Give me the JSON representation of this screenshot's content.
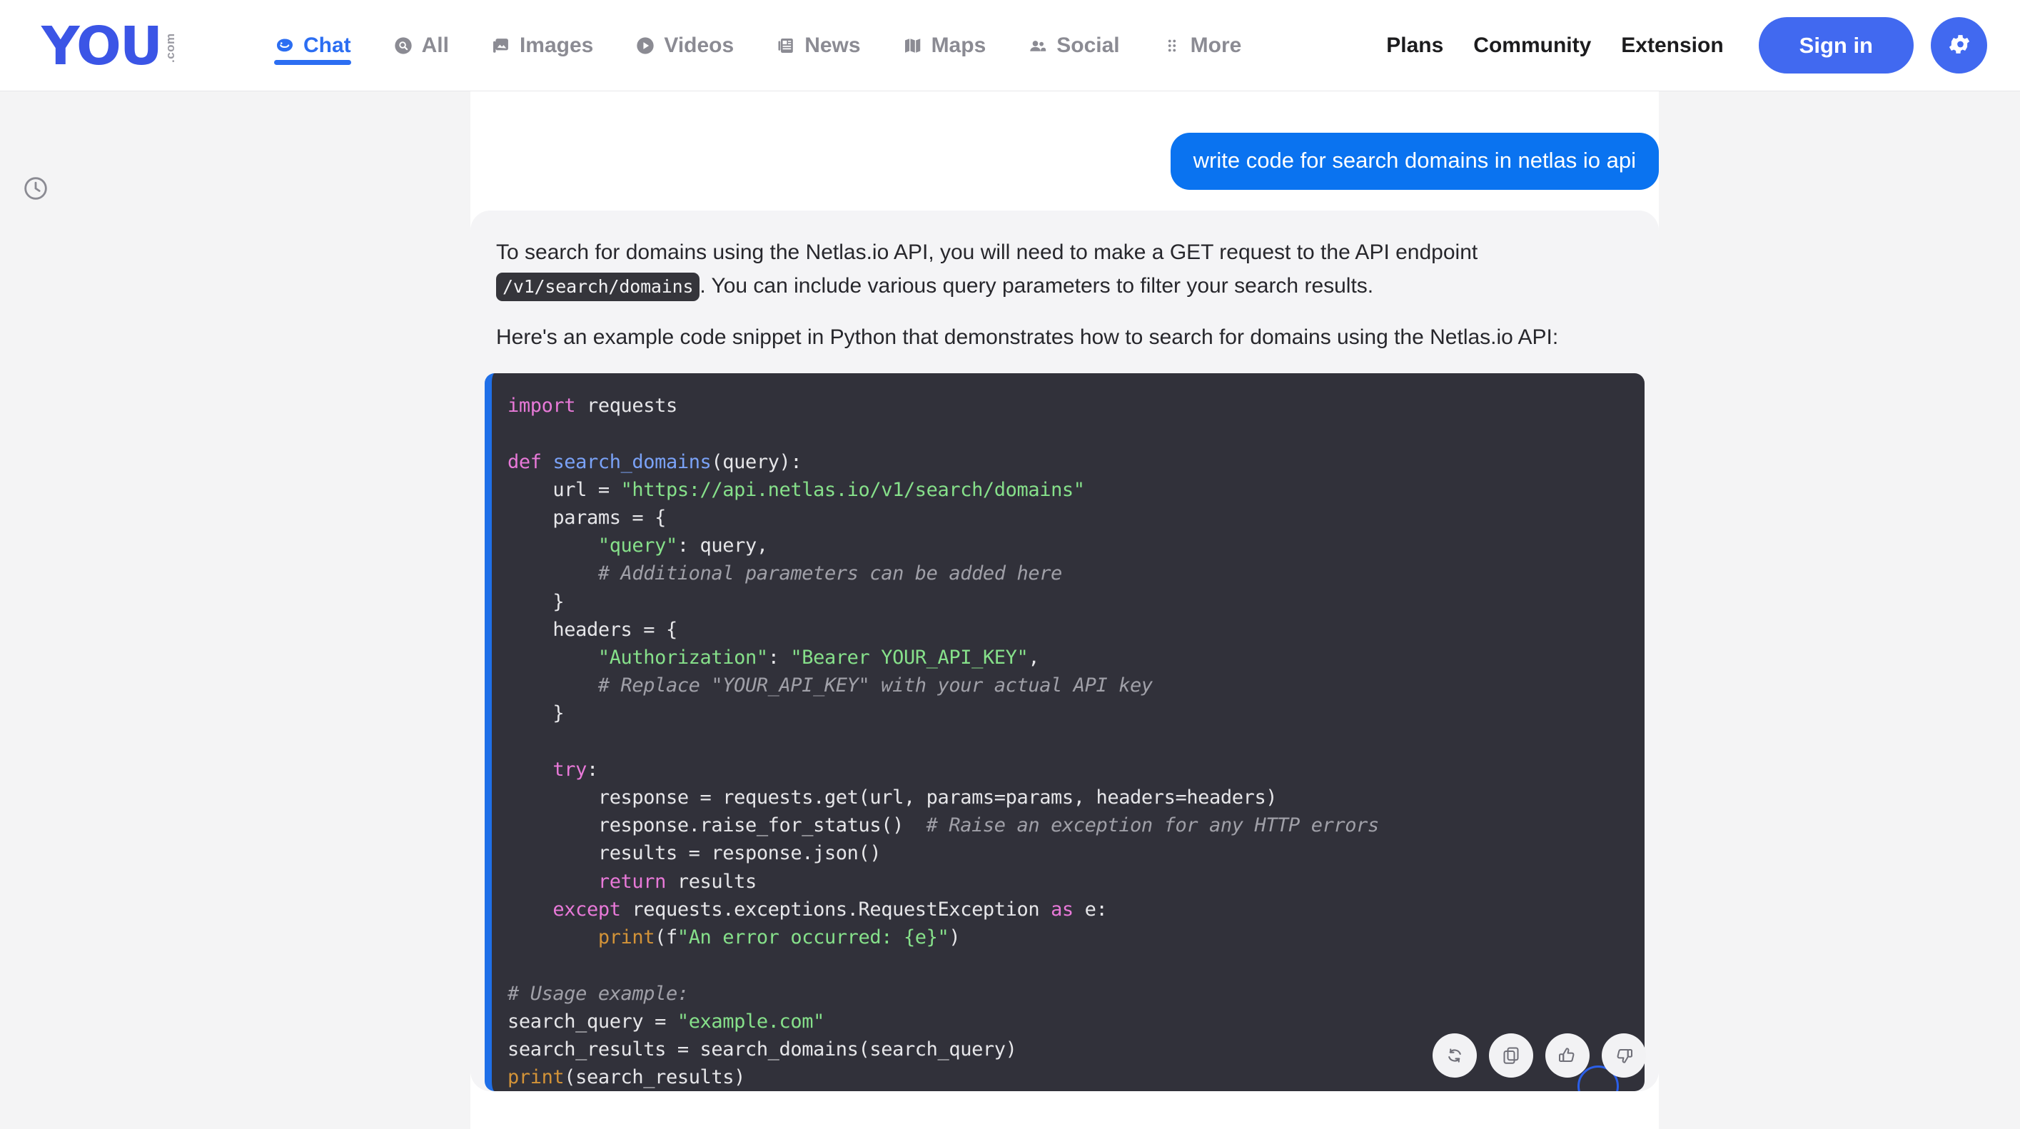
{
  "header": {
    "logo": {
      "text": "YOU",
      "suffix": ".com"
    },
    "nav_tabs": [
      {
        "label": "Chat",
        "icon": "chat-blob-icon",
        "active": true
      },
      {
        "label": "All",
        "icon": "search-circle-icon",
        "active": false
      },
      {
        "label": "Images",
        "icon": "image-icon",
        "active": false
      },
      {
        "label": "Videos",
        "icon": "play-circle-icon",
        "active": false
      },
      {
        "label": "News",
        "icon": "newspaper-icon",
        "active": false
      },
      {
        "label": "Maps",
        "icon": "map-icon",
        "active": false
      },
      {
        "label": "Social",
        "icon": "people-icon",
        "active": false
      },
      {
        "label": "More",
        "icon": "dots-grid-icon",
        "active": false
      }
    ],
    "links": [
      {
        "label": "Plans"
      },
      {
        "label": "Community"
      },
      {
        "label": "Extension"
      }
    ],
    "sign_in_label": "Sign in",
    "settings_icon": "gear-icon",
    "accent_color": "#4169f0",
    "logo_color": "#3b55e6"
  },
  "sidebar": {
    "history_icon": "clock-icon"
  },
  "conversation": {
    "user_message": "write code for search domains in netlas io api",
    "user_bubble_color": "#0a73f0",
    "assistant": {
      "paragraph_1_before": "To search for domains using the Netlas.io API, you will need to make a GET request to the API endpoint ",
      "inline_code": "/v1/search/domains",
      "paragraph_1_after": ". You can include various query parameters to filter your search results.",
      "paragraph_2": "Here's an example code snippet in Python that demonstrates how to search for domains using the Netlas.io API:",
      "code": {
        "language": "python",
        "accent_bar_color": "#1f6fe8",
        "background": "#31313a",
        "lines": [
          [
            {
              "t": "import",
              "c": "kw"
            },
            {
              "t": " requests",
              "c": "pl"
            }
          ],
          [],
          [
            {
              "t": "def",
              "c": "kw"
            },
            {
              "t": " ",
              "c": "pl"
            },
            {
              "t": "search_domains",
              "c": "fn"
            },
            {
              "t": "(query):",
              "c": "pl"
            }
          ],
          [
            {
              "t": "    url = ",
              "c": "pl"
            },
            {
              "t": "\"https://api.netlas.io/v1/search/domains\"",
              "c": "str"
            }
          ],
          [
            {
              "t": "    params = {",
              "c": "pl"
            }
          ],
          [
            {
              "t": "        ",
              "c": "pl"
            },
            {
              "t": "\"query\"",
              "c": "str"
            },
            {
              "t": ": query,",
              "c": "pl"
            }
          ],
          [
            {
              "t": "        # Additional parameters can be added here",
              "c": "com"
            }
          ],
          [
            {
              "t": "    }",
              "c": "pl"
            }
          ],
          [
            {
              "t": "    headers = {",
              "c": "pl"
            }
          ],
          [
            {
              "t": "        ",
              "c": "pl"
            },
            {
              "t": "\"Authorization\"",
              "c": "str"
            },
            {
              "t": ": ",
              "c": "pl"
            },
            {
              "t": "\"Bearer YOUR_API_KEY\"",
              "c": "str"
            },
            {
              "t": ",",
              "c": "pl"
            }
          ],
          [
            {
              "t": "        # Replace \"YOUR_API_KEY\" with your actual API key",
              "c": "com"
            }
          ],
          [
            {
              "t": "    }",
              "c": "pl"
            }
          ],
          [],
          [
            {
              "t": "    ",
              "c": "pl"
            },
            {
              "t": "try",
              "c": "kw"
            },
            {
              "t": ":",
              "c": "pl"
            }
          ],
          [
            {
              "t": "        response = requests.get(url, params=params, headers=headers)",
              "c": "pl"
            }
          ],
          [
            {
              "t": "        response.raise_for_status()  ",
              "c": "pl"
            },
            {
              "t": "# Raise an exception for any HTTP errors",
              "c": "com"
            }
          ],
          [
            {
              "t": "        results = response.json()",
              "c": "pl"
            }
          ],
          [
            {
              "t": "        ",
              "c": "pl"
            },
            {
              "t": "return",
              "c": "kw"
            },
            {
              "t": " results",
              "c": "pl"
            }
          ],
          [
            {
              "t": "    ",
              "c": "pl"
            },
            {
              "t": "except",
              "c": "kw"
            },
            {
              "t": " requests.exceptions.RequestException ",
              "c": "pl"
            },
            {
              "t": "as",
              "c": "kw"
            },
            {
              "t": " e:",
              "c": "pl"
            }
          ],
          [
            {
              "t": "        ",
              "c": "pl"
            },
            {
              "t": "print",
              "c": "bi"
            },
            {
              "t": "(f",
              "c": "pl"
            },
            {
              "t": "\"An error occurred: {e}\"",
              "c": "str"
            },
            {
              "t": ")",
              "c": "pl"
            }
          ],
          [],
          [
            {
              "t": "# Usage example:",
              "c": "com"
            }
          ],
          [
            {
              "t": "search_query = ",
              "c": "pl"
            },
            {
              "t": "\"example.com\"",
              "c": "str"
            }
          ],
          [
            {
              "t": "search_results = search_domains(search_query)",
              "c": "pl"
            }
          ],
          [
            {
              "t": "print",
              "c": "bi"
            },
            {
              "t": "(search_results)",
              "c": "pl"
            }
          ]
        ]
      }
    },
    "actions": [
      {
        "icon": "regenerate-icon",
        "name": "regenerate"
      },
      {
        "icon": "copy-icon",
        "name": "copy"
      },
      {
        "icon": "thumbs-up-icon",
        "name": "thumbs-up"
      },
      {
        "icon": "thumbs-down-icon",
        "name": "thumbs-down"
      }
    ]
  }
}
